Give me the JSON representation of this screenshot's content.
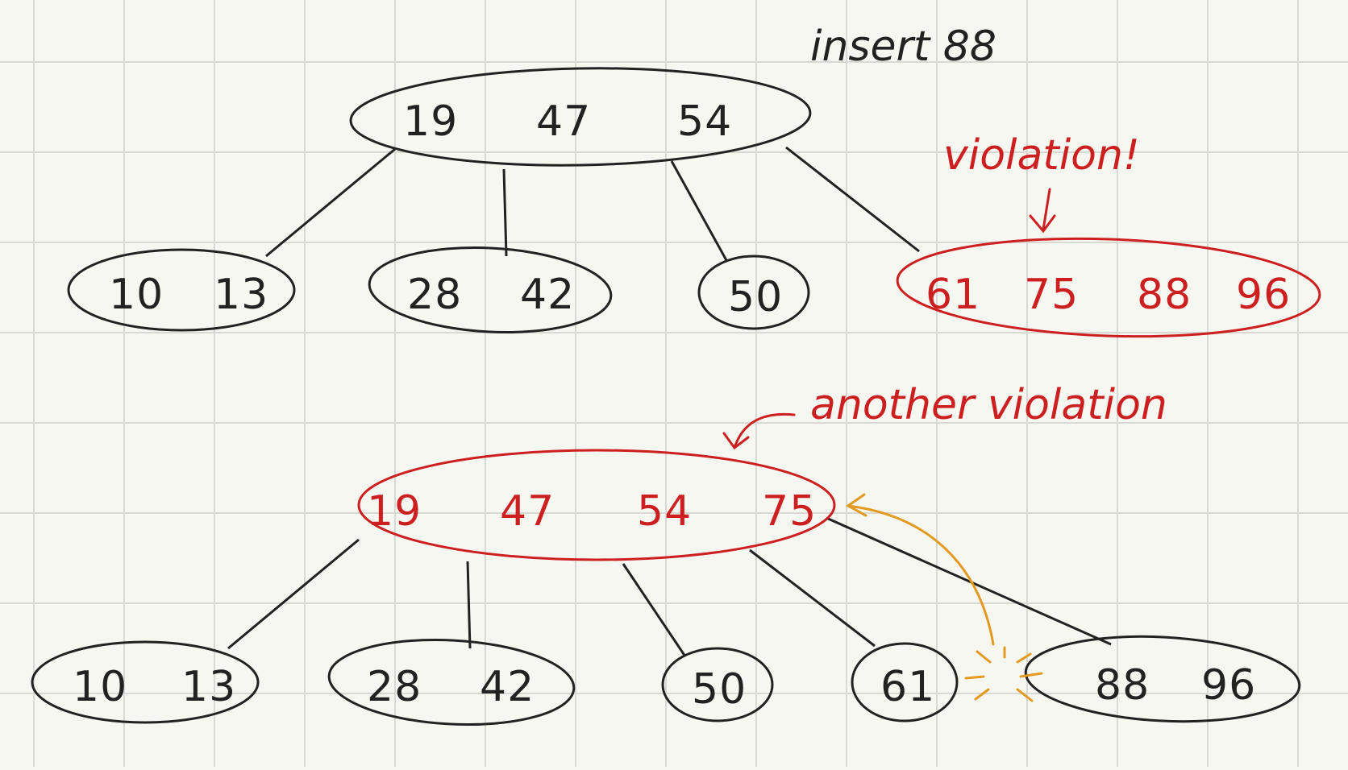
{
  "title": "insert 88",
  "colors": {
    "paper": "#f7f7f2",
    "grid": "#d9d9d4",
    "ink": "#222222",
    "violation": "#cc1f1f",
    "promote": "#e39a23"
  },
  "trees": [
    {
      "id": "before-split",
      "root": {
        "keys": [
          "19",
          "47",
          "54"
        ],
        "state": "normal"
      },
      "children": [
        {
          "keys": [
            "10",
            "13"
          ],
          "state": "normal"
        },
        {
          "keys": [
            "28",
            "42"
          ],
          "state": "normal"
        },
        {
          "keys": [
            "50"
          ],
          "state": "normal"
        },
        {
          "keys": [
            "61",
            "75",
            "88",
            "96"
          ],
          "state": "violation"
        }
      ]
    },
    {
      "id": "after-split",
      "root": {
        "keys": [
          "19",
          "47",
          "54",
          "75"
        ],
        "state": "violation"
      },
      "children": [
        {
          "keys": [
            "10",
            "13"
          ],
          "state": "normal"
        },
        {
          "keys": [
            "28",
            "42"
          ],
          "state": "normal"
        },
        {
          "keys": [
            "50"
          ],
          "state": "normal"
        },
        {
          "keys": [
            "61"
          ],
          "state": "normal"
        },
        {
          "keys": [
            "88",
            "96"
          ],
          "state": "normal"
        }
      ]
    }
  ],
  "annotations": {
    "violation_1": "violation!",
    "violation_2": "another violation"
  },
  "icons": {
    "promote_arrow": "curved-arrow-icon",
    "split_burst": "burst-icon"
  }
}
